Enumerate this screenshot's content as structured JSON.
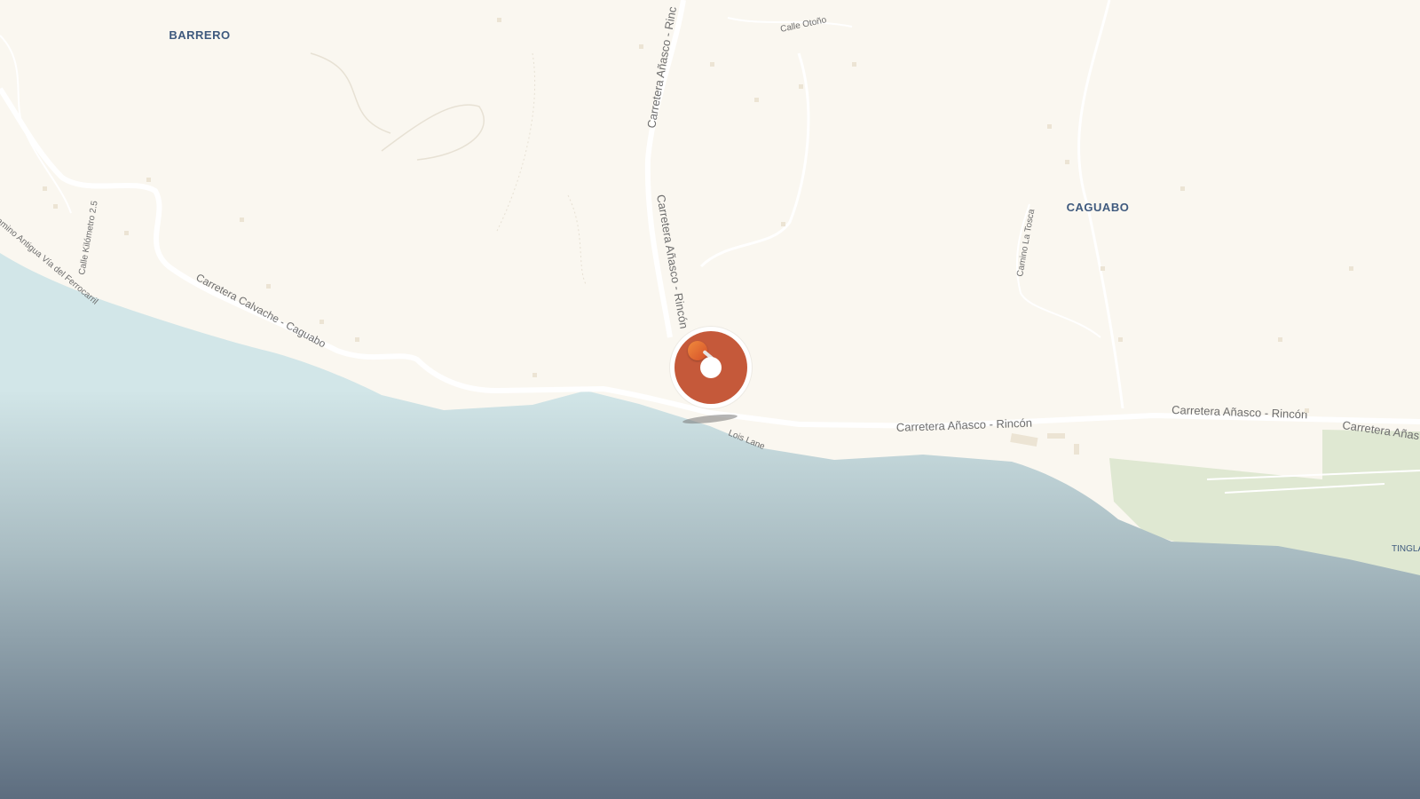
{
  "map": {
    "areas": [
      {
        "label": "BARRERO"
      },
      {
        "label": "CAGUABO"
      },
      {
        "label": "TINGLA"
      }
    ],
    "roads": {
      "carretera_anasco_rincon": "Carretera Añasco - Rincón",
      "carretera_anasco_rincon_east": "Carretera Añasco - Rincón",
      "carretera_anasco_rincon_far": "Carretera Añas",
      "carretera_anasco_rincon_north_1": "Carretera Añasco - Rinc",
      "carretera_anasco_rincon_north_2": "Carretera Añasco - Rincón",
      "carretera_calvache_caguabo": "Carretera Calvache - Caguabo",
      "camino_antigua_via": "Camino Antigua Vía del Ferrocarril",
      "calle_kilometro": "Calle Kilómetro 2.5",
      "calle_otono": "Calle Otoño",
      "camino_la_tosca": "Camino La Tosca",
      "lois_lane": "Lois Lane"
    },
    "colors": {
      "land": "#faf7f0",
      "water": "#d2e6e8",
      "park": "#dfe8d2",
      "road": "#ffffff",
      "area_label": "#3f5a7e",
      "road_label": "#6e6e6e",
      "marker": "#c5593a"
    },
    "marker": {
      "icon": "location-pin-icon"
    }
  }
}
